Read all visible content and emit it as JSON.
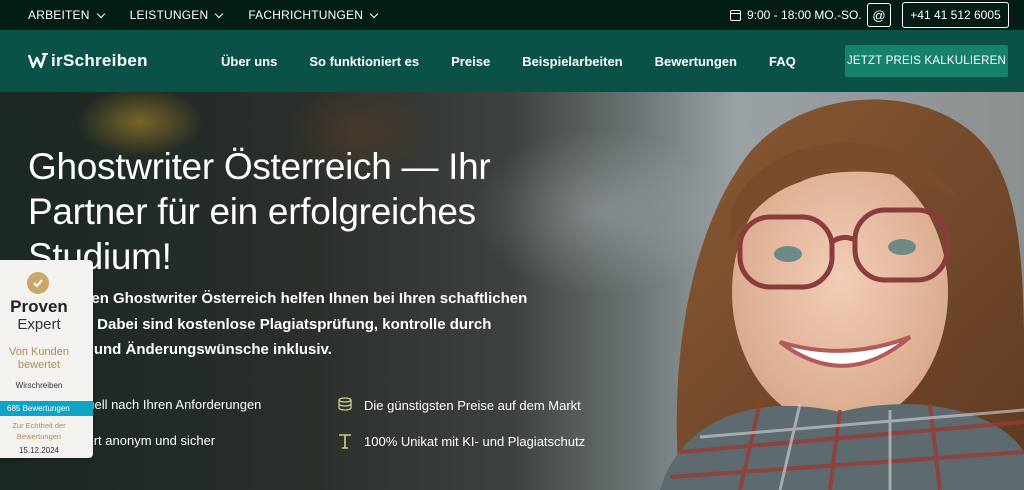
{
  "topbar": {
    "nav": [
      {
        "label": "ARBEITEN",
        "icon": "chevron-down-icon"
      },
      {
        "label": "LEISTUNGEN",
        "icon": "chevron-down-icon"
      },
      {
        "label": "FACHRICHTUNGEN",
        "icon": "chevron-down-icon"
      }
    ],
    "hours_icon": "calendar-icon",
    "hours": "9:00 - 18:00 MO.-SO.",
    "email_symbol": "@",
    "phone": "+41 41 512 6005"
  },
  "header": {
    "logo_text": "irSchreiben",
    "nav": [
      "Über uns",
      "So funktioniert es",
      "Preise",
      "Beispielarbeiten",
      "Bewertungen",
      "FAQ"
    ],
    "cta": "JETZT PREIS KALKULIEREN",
    "colors": {
      "topbar": "#031d16",
      "nav": "#0a5248",
      "cta": "#16826b"
    }
  },
  "hero": {
    "title": "Ghostwriter Österreich — Ihr Partner für ein erfolgreiches Studium!",
    "text": "ertifizierten Ghostwriter Österreich helfen Ihnen bei Ihren schaftlichen Arbeiten. Dabei sind kostenlose Plagiatsprüfung, kontrolle durch Manager und Änderungswünsche inklusiv.",
    "features": [
      {
        "text": "duell nach Ihren Anforderungen",
        "icon": "check-icon"
      },
      {
        "text": "Die günstigsten Preise auf dem Markt",
        "icon": "coins-icon"
      },
      {
        "text": "tiert anonym und sicher",
        "icon": "shield-icon"
      },
      {
        "text": "100% Unikat mit KI- und Plagiatschutz",
        "icon": "text-t-icon"
      }
    ]
  },
  "proven_expert": {
    "brand_line1": "Proven",
    "brand_line2": "Expert",
    "label": "Von Kunden bewertet",
    "company": "Wirschreiben",
    "reviews": "685 Bewertungen",
    "check_label": "Zur Echtheit der Bewertungen",
    "date": "15.12.2024",
    "accent": "#11a3c4"
  }
}
